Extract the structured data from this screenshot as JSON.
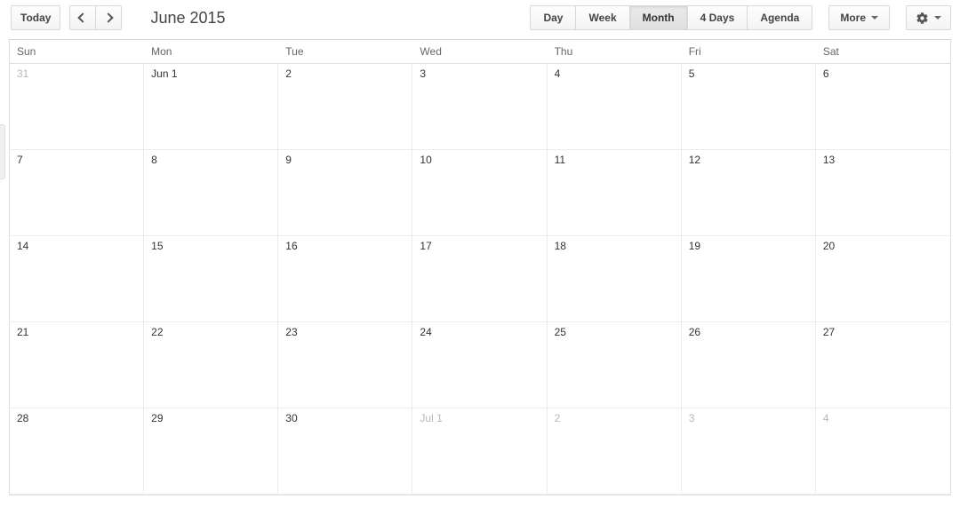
{
  "toolbar": {
    "today_label": "Today",
    "title": "June 2015",
    "views": [
      {
        "id": "day",
        "label": "Day",
        "active": false
      },
      {
        "id": "week",
        "label": "Week",
        "active": false
      },
      {
        "id": "month",
        "label": "Month",
        "active": true
      },
      {
        "id": "4days",
        "label": "4 Days",
        "active": false
      },
      {
        "id": "agenda",
        "label": "Agenda",
        "active": false
      }
    ],
    "more_label": "More"
  },
  "calendar": {
    "dow": [
      "Sun",
      "Mon",
      "Tue",
      "Wed",
      "Thu",
      "Fri",
      "Sat"
    ],
    "cells": [
      {
        "label": "31",
        "out": true
      },
      {
        "label": "Jun 1",
        "out": false
      },
      {
        "label": "2",
        "out": false
      },
      {
        "label": "3",
        "out": false
      },
      {
        "label": "4",
        "out": false
      },
      {
        "label": "5",
        "out": false
      },
      {
        "label": "6",
        "out": false
      },
      {
        "label": "7",
        "out": false
      },
      {
        "label": "8",
        "out": false
      },
      {
        "label": "9",
        "out": false
      },
      {
        "label": "10",
        "out": false
      },
      {
        "label": "11",
        "out": false
      },
      {
        "label": "12",
        "out": false
      },
      {
        "label": "13",
        "out": false
      },
      {
        "label": "14",
        "out": false
      },
      {
        "label": "15",
        "out": false
      },
      {
        "label": "16",
        "out": false
      },
      {
        "label": "17",
        "out": false
      },
      {
        "label": "18",
        "out": false
      },
      {
        "label": "19",
        "out": false
      },
      {
        "label": "20",
        "out": false
      },
      {
        "label": "21",
        "out": false
      },
      {
        "label": "22",
        "out": false
      },
      {
        "label": "23",
        "out": false
      },
      {
        "label": "24",
        "out": false
      },
      {
        "label": "25",
        "out": false
      },
      {
        "label": "26",
        "out": false
      },
      {
        "label": "27",
        "out": false
      },
      {
        "label": "28",
        "out": false
      },
      {
        "label": "29",
        "out": false
      },
      {
        "label": "30",
        "out": false
      },
      {
        "label": "Jul 1",
        "out": true
      },
      {
        "label": "2",
        "out": true
      },
      {
        "label": "3",
        "out": true
      },
      {
        "label": "4",
        "out": true
      }
    ]
  }
}
